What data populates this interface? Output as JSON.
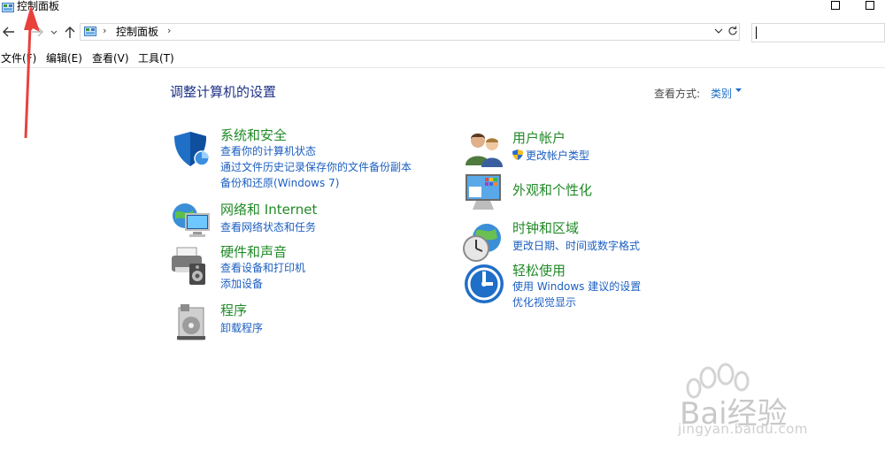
{
  "window": {
    "title": "控制面板"
  },
  "address": {
    "crumb": "控制面板",
    "sep": "›"
  },
  "search": {
    "placeholder": ""
  },
  "menu": {
    "file": "文件(F)",
    "edit": "编辑(E)",
    "view": "查看(V)",
    "tools": "工具(T)"
  },
  "main": {
    "heading": "调整计算机的设置",
    "view_by_label": "查看方式:",
    "view_by_value": "类别"
  },
  "categories": {
    "system_security": {
      "title": "系统和安全",
      "links": [
        "查看你的计算机状态",
        "通过文件历史记录保存你的文件备份副本",
        "备份和还原(Windows 7)"
      ]
    },
    "network": {
      "title": "网络和 Internet",
      "links": [
        "查看网络状态和任务"
      ]
    },
    "hardware": {
      "title": "硬件和声音",
      "links": [
        "查看设备和打印机",
        "添加设备"
      ]
    },
    "programs": {
      "title": "程序",
      "links": [
        "卸载程序"
      ]
    },
    "user_accounts": {
      "title": "用户帐户",
      "links": [
        "更改帐户类型"
      ]
    },
    "appearance": {
      "title": "外观和个性化",
      "links": []
    },
    "clock_region": {
      "title": "时钟和区域",
      "links": [
        "更改日期、时间或数字格式"
      ]
    },
    "ease_access": {
      "title": "轻松使用",
      "links": [
        "使用 Windows 建议的设置",
        "优化视觉显示"
      ]
    }
  },
  "watermark": {
    "brand": "Bai经验",
    "url": "jingyan.baidu.com"
  },
  "colors": {
    "title_green": "#208a27",
    "link_blue": "#1c5fc1",
    "heading_blue": "#1e3287",
    "annotation_red": "#e8413c"
  }
}
